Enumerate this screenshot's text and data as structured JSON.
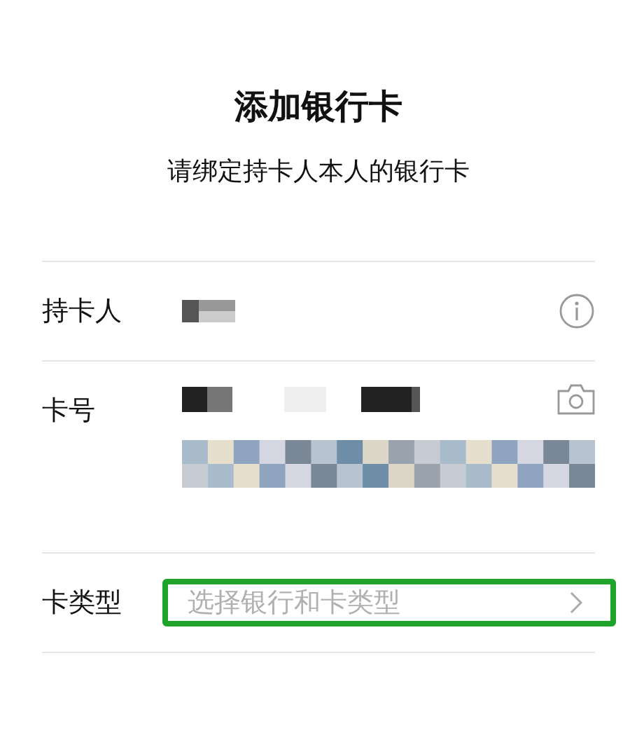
{
  "title": "添加银行卡",
  "subtitle": "请绑定持卡人本人的银行卡",
  "fields": [
    {
      "kind": "name",
      "label": "持卡人"
    },
    {
      "kind": "number",
      "label": "卡号"
    },
    {
      "kind": "select",
      "label": "卡类型",
      "placeholder": "选择银行和卡类型",
      "highlighted": true
    }
  ]
}
